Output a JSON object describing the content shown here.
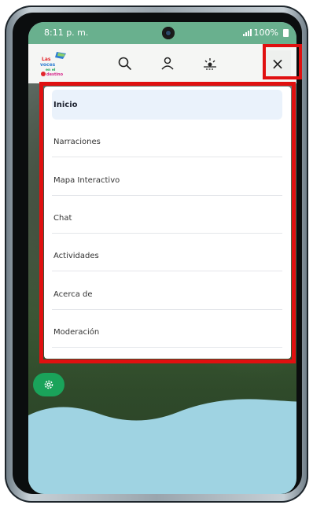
{
  "status_bar": {
    "time": "8:11 p. m.",
    "battery": "100%"
  },
  "header": {
    "logo_lines": [
      "Las",
      "voces",
      "en el",
      "destino"
    ],
    "icons": [
      "search-icon",
      "user-icon",
      "sun-icon"
    ],
    "close_symbol": "×"
  },
  "menu": {
    "items": [
      {
        "label": "Inicio",
        "active": true
      },
      {
        "label": "Narraciones"
      },
      {
        "label": "Mapa Interactivo"
      },
      {
        "label": "Chat"
      },
      {
        "label": "Actividades"
      },
      {
        "label": "Acerca de"
      },
      {
        "label": "Moderación"
      }
    ]
  },
  "colors": {
    "status_bar": "#69b08e",
    "highlight_frame": "#e01010",
    "active_item_bg": "#eaf2fb",
    "gear_button": "#1aa35a",
    "wave": "#9fd3e2"
  }
}
